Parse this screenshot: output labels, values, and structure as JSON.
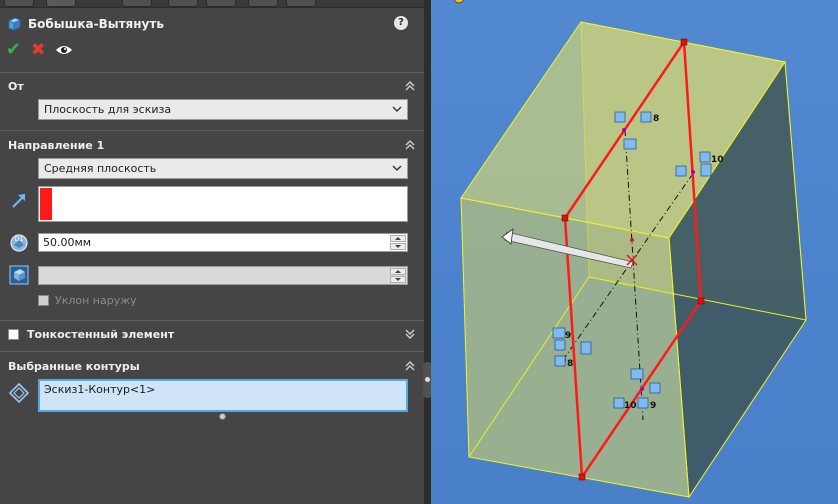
{
  "feature": {
    "title": "Бобышка-Вытянуть",
    "help": "?"
  },
  "actions": {
    "ok_icon": "check-icon",
    "cancel_icon": "cross-icon",
    "preview_icon": "eye-icon"
  },
  "from_group": {
    "header": "От",
    "selected": "Плоскость для эскиза"
  },
  "direction1": {
    "header": "Направление 1",
    "end_condition": "Средняя плоскость",
    "depth": "50.00мм",
    "draft_outward_label": "Уклон наружу"
  },
  "thin_feature": {
    "label": "Тонкостенный элемент"
  },
  "selected_contours": {
    "header": "Выбранные контуры",
    "value": "Эскиз1-Контур<1>"
  },
  "viewport": {
    "relations": [
      "8",
      "10",
      "9",
      "8",
      "9",
      "10"
    ]
  },
  "colors": {
    "panel_bg": "#454545",
    "viewport_bg": "#4b82cc",
    "accent_red": "#ff1a1a",
    "selection_blue": "#5ba4e3"
  }
}
